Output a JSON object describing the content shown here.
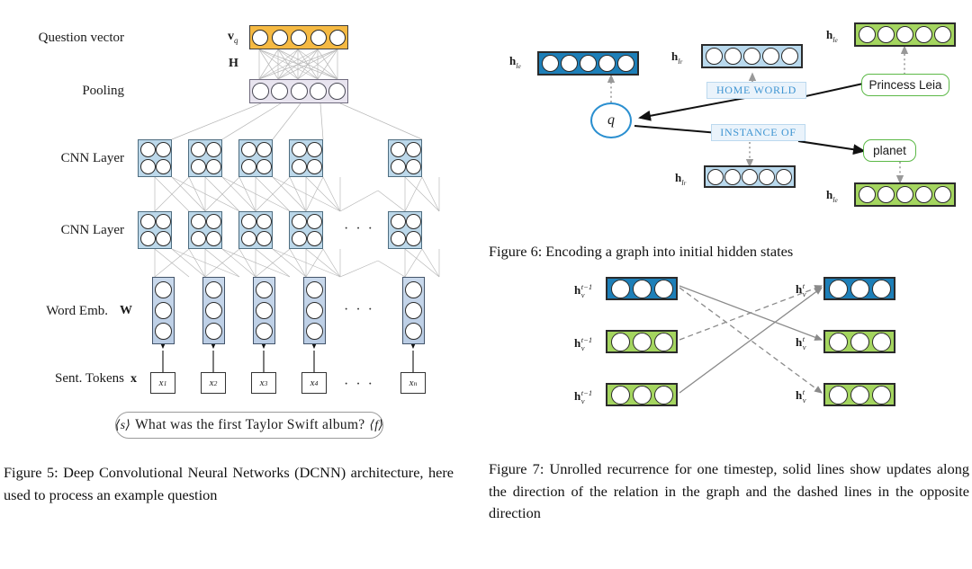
{
  "figure5": {
    "row_labels": [
      {
        "text": "Question vector"
      },
      {
        "text": "Pooling"
      },
      {
        "text": "CNN Layer"
      },
      {
        "text": "CNN Layer"
      },
      {
        "text": "Word Emb."
      },
      {
        "text": "Sent. Tokens"
      }
    ],
    "symbols": {
      "question_vector": "v",
      "question_vector_sub": "q",
      "projection": "H",
      "word_embedding": "W",
      "tokens": "x"
    },
    "tokens": [
      "x1",
      "x2",
      "x3",
      "x4",
      "xn"
    ],
    "token_subs": [
      "1",
      "2",
      "3",
      "4",
      "n"
    ],
    "ellipsis": "· · ·",
    "sentence": {
      "start_tag": "⟨s⟩",
      "text": "What was the first Taylor Swift album?",
      "end_tag": "⟨f⟩"
    },
    "caption": "Figure 5: Deep Convolutional Neural Networks (DCNN) architecture, here used to process an example question",
    "colors": {
      "question_vector": "#f5b942",
      "pooling": "#e8e4ef",
      "cnn": "#bcd8ea",
      "word_embedding": "#c2d4e9"
    }
  },
  "figure6": {
    "caption": "Figure 6: Encoding a graph into initial hidden states",
    "query_node": "q",
    "relations": [
      {
        "label": "HOME WORLD"
      },
      {
        "label": "INSTANCE OF"
      }
    ],
    "entities": [
      {
        "label": "Princess Leia"
      },
      {
        "label": "planet"
      }
    ],
    "state_labels": [
      {
        "base": "h",
        "sub": "le",
        "role": "query-entity"
      },
      {
        "base": "h",
        "sub": "lr",
        "role": "home-world-relation"
      },
      {
        "base": "h",
        "sub": "le",
        "role": "princess-leia-entity"
      },
      {
        "base": "h",
        "sub": "lr",
        "role": "instance-of-relation"
      },
      {
        "base": "h",
        "sub": "le",
        "role": "planet-entity"
      }
    ],
    "colors": {
      "query_vector": "#1d7fb8",
      "relation_vector": "#b9d9ed",
      "entity_vector": "#a4d55f",
      "relation_chip_text": "#3f95d2",
      "entity_border": "#5cb947",
      "query_border": "#2a8fd0"
    }
  },
  "figure7": {
    "caption": "Figure 7: Unrolled recurrence for one timestep, solid lines show updates along the direction of the relation in the graph and the dashed lines in the opposite direction",
    "left_labels": [
      "h t-1 v",
      "h t-1 v",
      "h t-1 v"
    ],
    "right_labels": [
      "h t v",
      "h t v",
      "h t v"
    ],
    "left_sup": "t−1",
    "right_sup": "t",
    "sub": "v",
    "base": "h",
    "left_colors": [
      "#1d7fb8",
      "#a4d55f",
      "#a4d55f"
    ],
    "right_colors": [
      "#1d7fb8",
      "#a4d55f",
      "#a4d55f"
    ],
    "line_styles": [
      "solid",
      "dashed"
    ]
  }
}
